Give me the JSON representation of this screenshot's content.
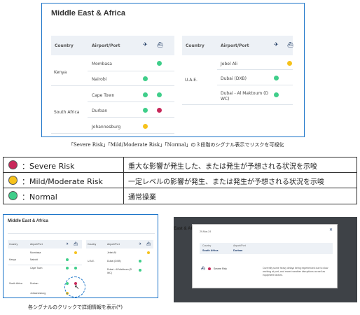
{
  "main": {
    "title": "Middle East & Africa",
    "left_table": {
      "headers": [
        "Country",
        "Airport/Port"
      ],
      "groups": [
        {
          "country": "Kenya",
          "ports": [
            {
              "name": "Mombasa",
              "air": "",
              "sea": "green"
            },
            {
              "name": "Nairobi",
              "air": "green",
              "sea": ""
            }
          ]
        },
        {
          "country": "South Africa",
          "ports": [
            {
              "name": "Cape Town",
              "air": "green",
              "sea": "green"
            },
            {
              "name": "Durban",
              "air": "green",
              "sea": "red"
            },
            {
              "name": "Johannesburg",
              "air": "yellow",
              "sea": ""
            }
          ]
        }
      ]
    },
    "right_table": {
      "headers": [
        "Country",
        "Airport/Port"
      ],
      "groups": [
        {
          "country": "U.A.E.",
          "ports": [
            {
              "name": "Jebel Ali",
              "air": "",
              "sea": "yellow"
            },
            {
              "name": "Dubai (DXB)",
              "air": "green",
              "sea": ""
            },
            {
              "name": "Dubai - Al Maktoum (D",
              "name2": "WC)",
              "air": "green",
              "sea": ""
            }
          ]
        }
      ]
    }
  },
  "caption_top": "「Severe Risk」「Mild/Moderate Risk」「Normal」の３段階のシグナル表示でリスクを可視化",
  "legend": [
    {
      "label": "：Severe Risk",
      "color": "#c8285a",
      "desc": "重大な影響が発生した、または発生が予想される状況を示唆"
    },
    {
      "label": "：Mild/Moderate Risk",
      "color": "#f6c21c",
      "desc": "一定レベルの影響が発生、または発生が予想される状況を示唆"
    },
    {
      "label": "：Normal",
      "color": "#3fce8a",
      "desc": "通常操業"
    }
  ],
  "mini": {
    "title": "Middle East & Africa",
    "headers": [
      "Country",
      "Airport/Port"
    ],
    "left": [
      {
        "country": "",
        "port": "Mombasa"
      },
      {
        "country": "Kenya",
        "port": "Nairobi"
      },
      {
        "country": "",
        "port": "Cape Town"
      },
      {
        "country": "South Africa",
        "port": "Durban"
      },
      {
        "country": "",
        "port": "Johannesburg"
      }
    ],
    "right": [
      {
        "country": "",
        "port": "Jebel Ali"
      },
      {
        "country": "U.A.E.",
        "port": "Dubai (DXB)"
      },
      {
        "country": "",
        "port": "Dubai - Al Maktoum (D",
        "port2": "WC)"
      }
    ]
  },
  "caption_bottom": "各シグナルのクリックで詳細情報を表示(*)",
  "modal": {
    "bg_title": "East & Af",
    "date": "29-Mar-24",
    "close": "✕",
    "country_label": "Country",
    "country_value": "South Africa",
    "port_label": "Airport/Port",
    "port_value": "Durban",
    "risk_label": "Severe Risk",
    "text": "Currently some heavy delays being experienced due to slow working at port, and recent weather disruptions as well as equipment factors."
  }
}
